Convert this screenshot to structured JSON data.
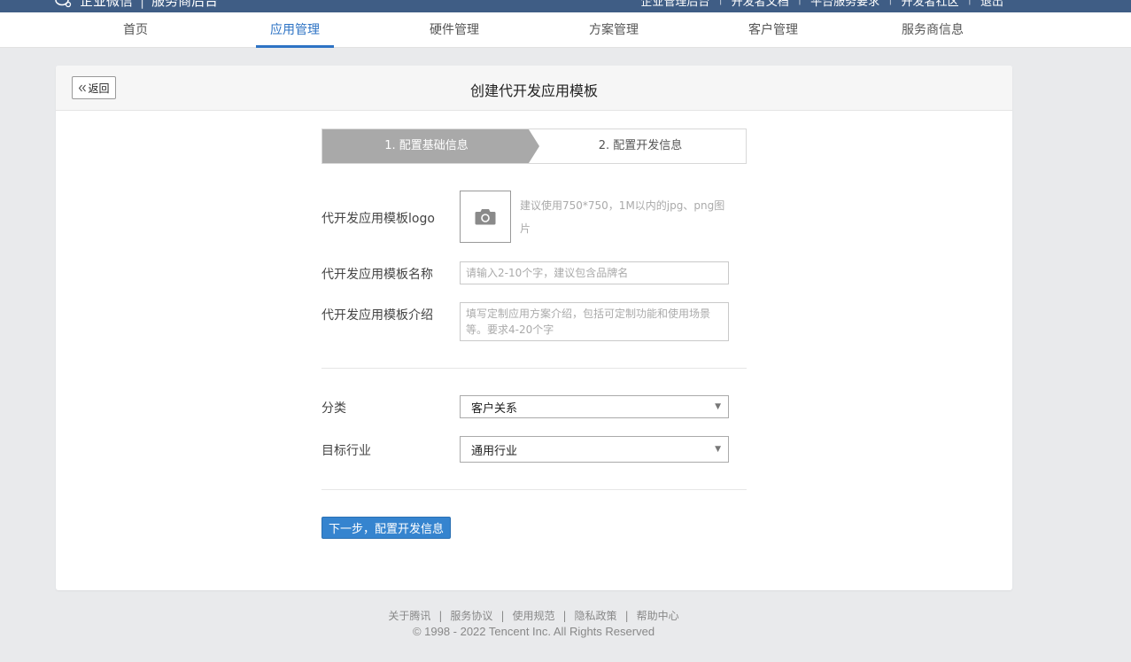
{
  "topbar": {
    "brand_name": "企业微信",
    "brand_sep": "|",
    "brand_sub": "服务商后台",
    "links": [
      "企业管理后台",
      "开发者文档",
      "平台服务要求",
      "开发者社区",
      "退出"
    ],
    "bg_color": "#3f5d85"
  },
  "nav": {
    "tabs": [
      "首页",
      "应用管理",
      "硬件管理",
      "方案管理",
      "客户管理",
      "服务商信息"
    ],
    "active_index": 1,
    "accent_color": "#2d73c4"
  },
  "page": {
    "back_label": "返回",
    "back_icon": "double-chevron-left-icon",
    "title": "创建代开发应用模板"
  },
  "steps": {
    "step1": "1. 配置基础信息",
    "step2": "2. 配置开发信息",
    "active_color": "#a9a9a9"
  },
  "form": {
    "logo_label": "代开发应用模板logo",
    "logo_icon": "camera-icon",
    "logo_hint": "建议使用750*750，1M以内的jpg、png图片",
    "name_label": "代开发应用模板名称",
    "name_placeholder": "请输入2-10个字，建议包含品牌名",
    "desc_label": "代开发应用模板介绍",
    "desc_placeholder": "填写定制应用方案介绍，包括可定制功能和使用场景等。要求4-20个字",
    "category_label": "分类",
    "category_value": "客户关系",
    "industry_label": "目标行业",
    "industry_value": "通用行业",
    "next_label": "下一步，配置开发信息",
    "button_color": "#3584cf"
  },
  "footer": {
    "links": [
      "关于腾讯",
      "服务协议",
      "使用规范",
      "隐私政策",
      "帮助中心"
    ],
    "copyright": "© 1998 - 2022 Tencent Inc. All Rights Reserved"
  }
}
